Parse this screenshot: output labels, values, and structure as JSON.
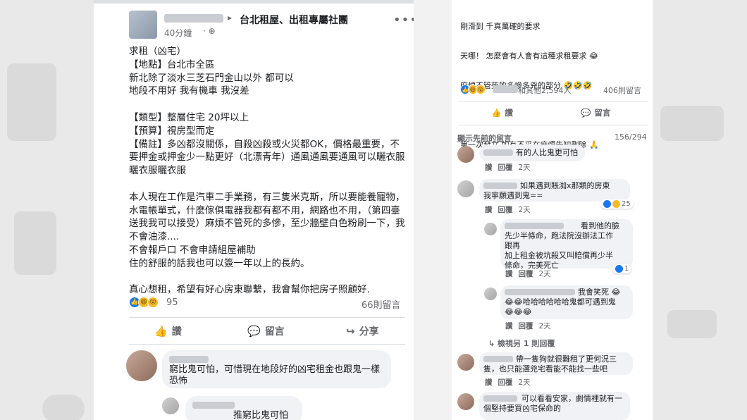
{
  "post": {
    "group_name": "台北租屋、出租專屬社團",
    "timestamp": "40分鐘",
    "separator": "·",
    "globe_icon": "globe-icon",
    "arrow_icon": "caret-right-icon",
    "more_icon": "more-icon",
    "body_lines": [
      "求租（凶宅）",
      "【地點】台北市全區",
      "新北除了淡水三芝石門金山以外 都可以",
      "地段不用好 我有機車 我沒差",
      "",
      "【類型】整層住宅 20坪以上",
      "【預算】視房型而定",
      "【備註】多凶都沒關係，自殺凶殺或火災都OK，價格最重要，不要押金或押金少一點更好（北漂青年）通風通風要通風可以曬衣服曬衣服曬衣服",
      "",
      "本人現在工作是汽車二手業務，有三隻米克斯，所以要能養寵物，水電帳單式，什麼傢俱電器我都有都不用，網路也不用，（第四臺送我我可以接受）麻煩不管死的多慘，至少牆壁白色粉刷一下，我不會油漆....",
      "不會報戶口 不會申請組屋補助",
      "住的舒服的話我也可以簽一年以上的長約。",
      "",
      "真心想租，希望有好心房東聯繫，我會幫你把房子照顧好."
    ],
    "reaction_count": "95",
    "comment_count": "66則留言",
    "actions": {
      "like": "讚",
      "comment": "留言",
      "share": "分享"
    },
    "comments": [
      {
        "text": "窮比鬼可怕，可惜現在地段好的凶宅租金也跟鬼一樣恐怖"
      },
      {
        "text": "推窮比鬼可怕"
      }
    ]
  },
  "right": {
    "top_lines": [
      "剛滑到 千真萬確的要求",
      "天哪！ 怎麼會有人會有這種求租要求 😂",
      "麻煩不管死的多慘多兇的部分 🤣🤣🤣",
      "",
      "第一次發文 如有不妥在麻煩告知刪除 🙏"
    ],
    "reactors_text": "和其他2,594人",
    "comment_count": "406則留言",
    "actions": {
      "like": "讚",
      "comment": "留言"
    },
    "show_previous": "顯示先前的留言",
    "pagination": "156/294",
    "comments": [
      {
        "text": "有的人比鬼更可怕",
        "meta_like": "讚",
        "meta_reply": "回覆",
        "meta_time": "2天"
      },
      {
        "text": "如果遇到賬洳x那類的房東\n我寧願遇到鬼==",
        "meta_like": "讚",
        "meta_reply": "回覆",
        "meta_time": "2天",
        "reactions": "25"
      },
      {
        "text": "看到他的臉\n先少半條命，跑法院沒辦法工作\n跟再\n加上租金被坑殺又叫賠償再少半\n條命，完美死亡",
        "meta_like": "讚",
        "meta_reply": "回覆",
        "meta_time": "2天",
        "reactions": "1"
      },
      {
        "text": "我會笑死 😂\n😂😂哈哈哈哈哈哈鬼都可遇到鬼\n😂😂😂",
        "meta_like": "讚",
        "meta_reply": "回覆",
        "meta_time": "2天"
      },
      {
        "text": "檢視另 1 則回覆"
      },
      {
        "text": "帶一隻狗就很難租了更何況三\n隻，也只能選兇宅看能不能找一些吧",
        "meta_like": "讚",
        "meta_reply": "回覆",
        "meta_time": "2天"
      },
      {
        "text": "可以看看安家，劇情裡就有一\n個堅持要買凶宅保命的"
      }
    ]
  }
}
